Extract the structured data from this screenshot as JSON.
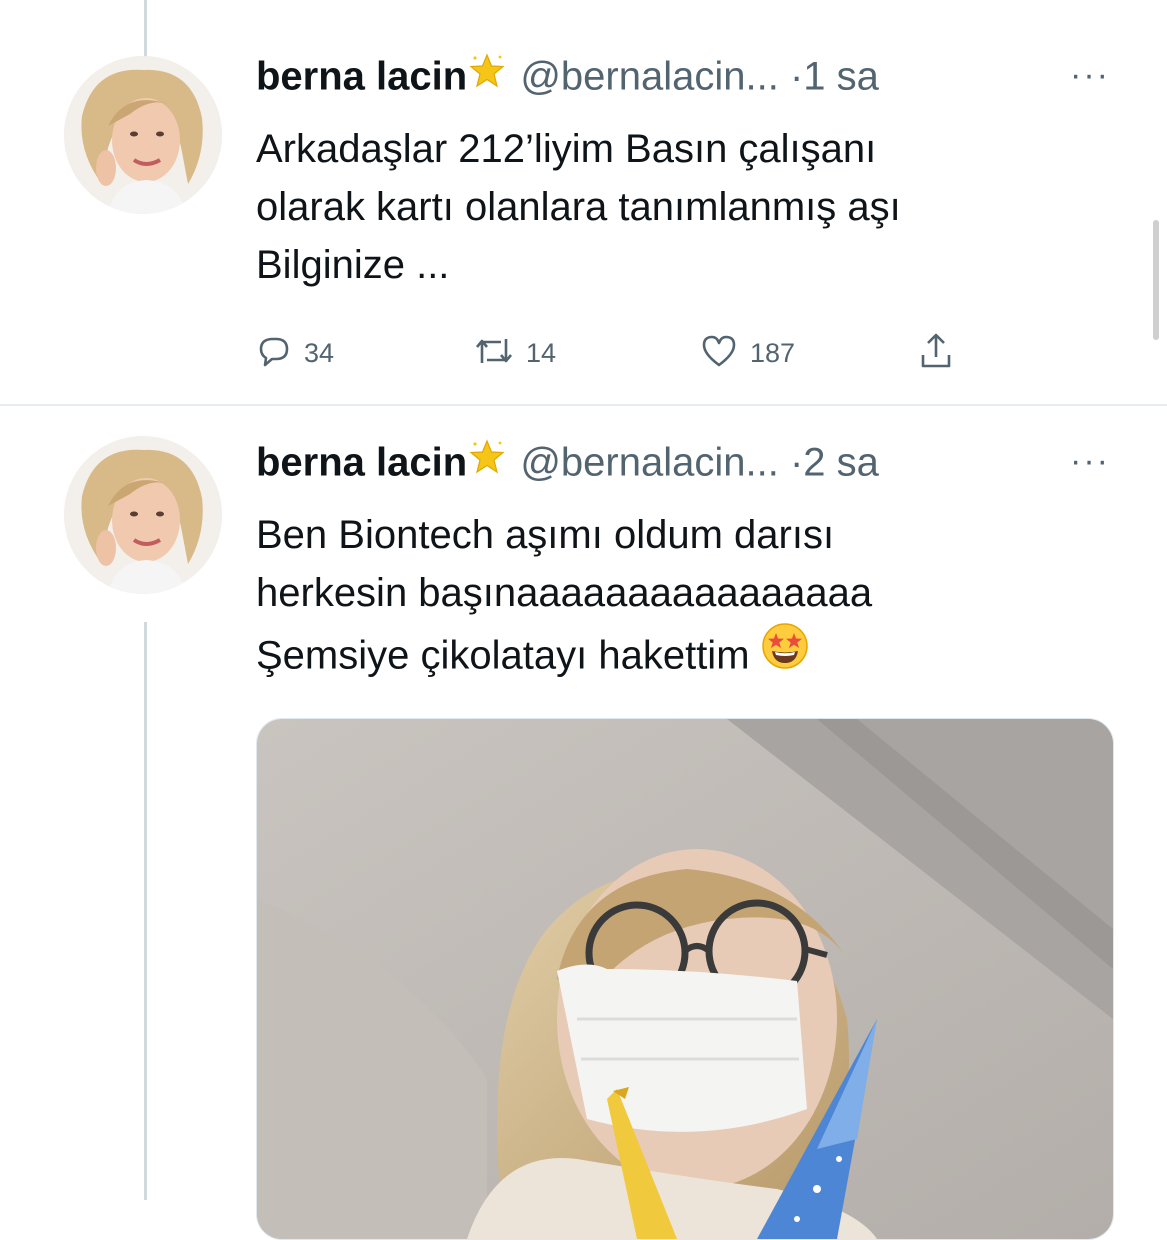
{
  "tweets": [
    {
      "author_name": "berna lacin",
      "handle": "@bernalacin...",
      "separator": "·",
      "time": "1 sa",
      "more": "···",
      "text_lines": [
        "Arkadaşlar 212’liyim Basın çalışanı",
        "olarak kartı olanlara tanımlanmış aşı",
        "Bilginize ..."
      ],
      "actions": {
        "replies": "34",
        "retweets": "14",
        "likes": "187"
      },
      "icons": [
        "reply-icon",
        "retweet-icon",
        "like-icon",
        "share-icon"
      ]
    },
    {
      "author_name": "berna lacin",
      "handle": "@bernalacin...",
      "separator": "·",
      "time": "2 sa",
      "more": "···",
      "text_lines": [
        "Ben Biontech aşımı oldum darısı",
        "herkesin başınaaaaaaaaaaaaaaaa",
        "Şemsiye çikolatayı hakettim"
      ],
      "emoji": "star-struck-emoji",
      "has_photo": true
    }
  ],
  "colors": {
    "text": "#0f1419",
    "meta": "#536471",
    "divider": "#e6ecf0",
    "thread_line": "#cfd9de",
    "star": "#f5c518"
  }
}
